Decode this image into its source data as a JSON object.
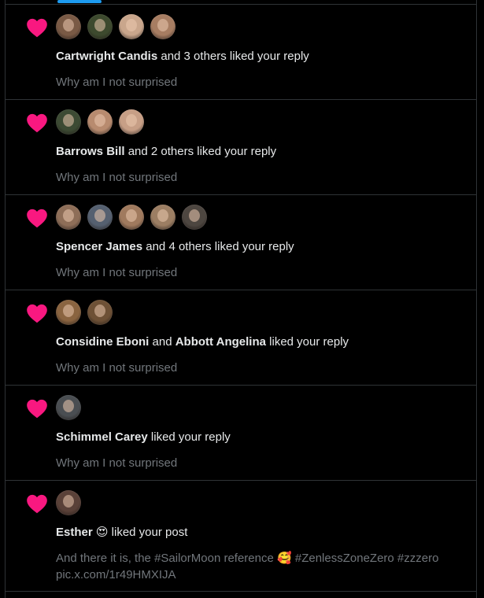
{
  "colors": {
    "heart": "#f91880",
    "accent": "#1d9bf0",
    "muted": "#71767b"
  },
  "notifications": [
    {
      "avatars": [
        "#7a5a45",
        "#3d4a2e",
        "#c9a68c",
        "#a77d62"
      ],
      "name1": "Cartwright Candis",
      "mid": "",
      "name2": "",
      "action": " and 3 others liked your reply",
      "preview": "Why am I not surprised"
    },
    {
      "avatars": [
        "#3c4a33",
        "#b88b6f",
        "#c79f86"
      ],
      "name1": "Barrows Bill",
      "mid": "",
      "name2": "",
      "action": " and 2 others liked your reply",
      "preview": "Why am I not surprised"
    },
    {
      "avatars": [
        "#8e6e58",
        "#556070",
        "#a07a5e",
        "#9c7e63",
        "#4d4640"
      ],
      "name1": "Spencer James",
      "mid": "",
      "name2": "",
      "action": " and 4 others liked your reply",
      "preview": "Why am I not surprised"
    },
    {
      "avatars": [
        "#8a6440",
        "#6e5136"
      ],
      "name1": "Considine Eboni",
      "mid": " and ",
      "name2": "Abbott Angelina",
      "action": " liked your reply",
      "preview": "Why am I not surprised"
    },
    {
      "avatars": [
        "#4a4e52"
      ],
      "name1": "Schimmel Carey",
      "mid": "",
      "name2": "",
      "action": " liked your reply",
      "preview": "Why am I not surprised"
    },
    {
      "avatars": [
        "#5a4138"
      ],
      "name1": "Esther",
      "emoji1": "😍",
      "mid": "",
      "name2": "",
      "action": " liked your post",
      "preview_line1_a": "And there it is, the #SailorMoon reference ",
      "preview_emoji": "🥰",
      "preview_line1_b": " #ZenlessZoneZero #zzzero",
      "preview_line2": "pic.x.com/1r49HMXIJA"
    }
  ]
}
